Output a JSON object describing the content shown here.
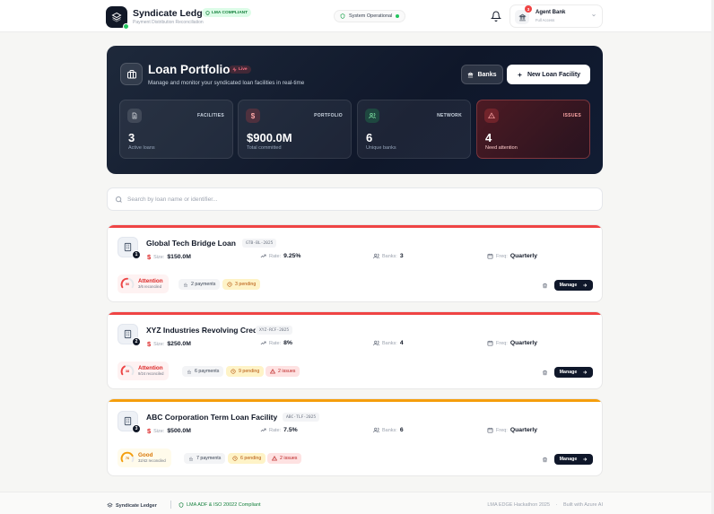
{
  "header": {
    "title": "Syndicate Ledger",
    "subtitle": "Payment Distribution Reconciliation",
    "compliance_badge": "LMA COMPLIANT",
    "status": "System Operational",
    "agent": {
      "name": "Agent Bank",
      "role": "Full Access",
      "notification_count": "3"
    }
  },
  "hero": {
    "title": "Loan Portfolio",
    "live_label": "Live",
    "subtitle": "Manage and monitor your syndicated loan facilities in real-time",
    "banks_button": "Banks",
    "new_button": "New Loan Facility",
    "stats": [
      {
        "label": "FACILITIES",
        "value": "3",
        "note": "Active loans"
      },
      {
        "label": "PORTFOLIO",
        "value": "$900.0M",
        "note": "Total committed"
      },
      {
        "label": "NETWORK",
        "value": "6",
        "note": "Unique banks"
      },
      {
        "label": "ISSUES",
        "value": "4",
        "note": "Need attention"
      }
    ]
  },
  "search": {
    "placeholder": "Search by loan name or identifier..."
  },
  "meta_labels": {
    "size": "Size:",
    "rate": "Rate:",
    "banks": "Banks:",
    "freq": "Freq:"
  },
  "manage_label": "Manage",
  "loans": [
    {
      "index": "1",
      "name": "Global Tech Bridge Loan",
      "code": "GTB-BL-2025",
      "size": "$150.0M",
      "rate": "9.25%",
      "banks": "3",
      "freq": "Quarterly",
      "health": {
        "title": "Attention",
        "sub": "3/6 reconciled",
        "score": "50",
        "fraction": 0.5
      },
      "payments": "2 payments",
      "pending": "3 pending",
      "issues": "",
      "accent": "#ef4444"
    },
    {
      "index": "2",
      "name": "XYZ Industries Revolving Credit",
      "code": "XYZ-RCF-2025",
      "size": "$250.0M",
      "rate": "8%",
      "banks": "4",
      "freq": "Quarterly",
      "health": {
        "title": "Attention",
        "sub": "9/24 reconciled",
        "score": "38",
        "fraction": 0.38
      },
      "payments": "6 payments",
      "pending": "9 pending",
      "issues": "2 issues",
      "accent": "#ef4444"
    },
    {
      "index": "3",
      "name": "ABC Corporation Term Loan Facility",
      "code": "ABC-TLF-2025",
      "size": "$500.0M",
      "rate": "7.5%",
      "banks": "6",
      "freq": "Quarterly",
      "health": {
        "title": "Good",
        "sub": "32/42 reconciled",
        "score": "76",
        "fraction": 0.76
      },
      "payments": "7 payments",
      "pending": "6 pending",
      "issues": "2 issues",
      "accent": "#f59e0b"
    }
  ],
  "footer": {
    "brand": "Syndicate Ledger",
    "compliance": "LMA ADF & ISO 20022 Compliant",
    "event": "LMA EDGE Hackathon 2025",
    "separator": "·",
    "built": "Built with Azure AI"
  },
  "colors": {
    "accent_red": "#ef4444",
    "accent_amber": "#f59e0b",
    "brand_dark": "#0f172a",
    "success": "#22c55e"
  }
}
